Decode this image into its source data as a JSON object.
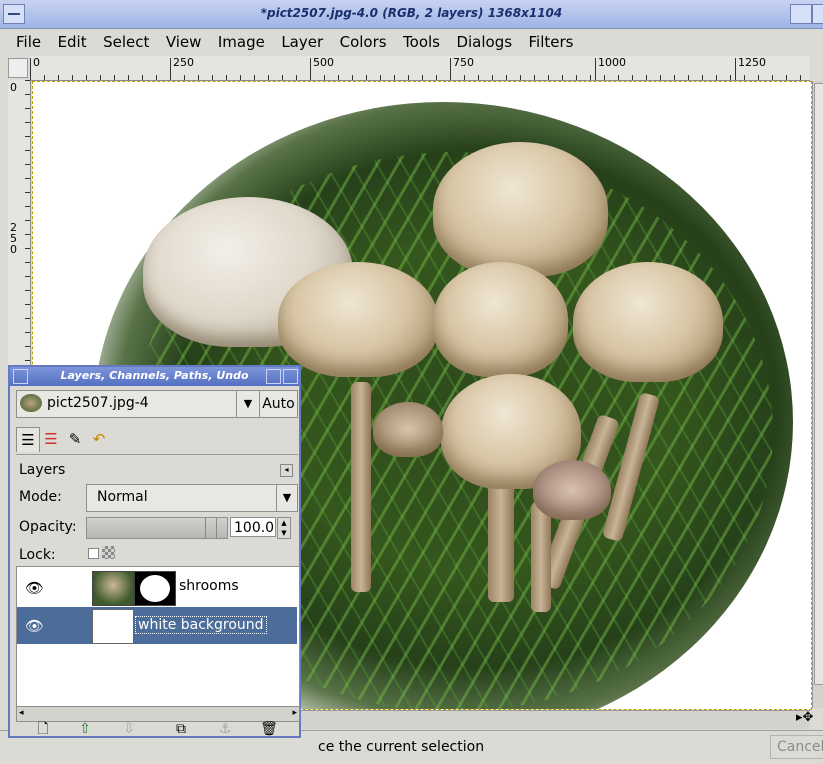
{
  "window": {
    "title": "*pict2507.jpg-4.0 (RGB, 2 layers) 1368x1104"
  },
  "menubar": {
    "items": [
      "File",
      "Edit",
      "Select",
      "View",
      "Image",
      "Layer",
      "Colors",
      "Tools",
      "Dialogs",
      "Filters"
    ]
  },
  "ruler": {
    "h_ticks": [
      "0",
      "250",
      "500",
      "750",
      "1000",
      "1250"
    ],
    "v_ticks": [
      "0",
      "2",
      "5",
      "0"
    ]
  },
  "status": {
    "message": "ce the current selection",
    "cancel_label": "Cancel"
  },
  "layers_dialog": {
    "title": "Layers, Channels, Paths, Undo",
    "image_name": "pict2507.jpg-4",
    "auto_label": "Auto",
    "section_label": "Layers",
    "mode_label": "Mode:",
    "mode_value": "Normal",
    "opacity_label": "Opacity:",
    "opacity_value": "100.0",
    "opacity_fraction": 1.0,
    "lock_label": "Lock:",
    "layers": [
      {
        "name": "shrooms",
        "visible": true,
        "selected": false
      },
      {
        "name": "white background",
        "visible": true,
        "selected": true
      }
    ]
  },
  "icons": {
    "eye": "👁",
    "new_layer": "🗋",
    "raise": "⇧",
    "lower": "⇩",
    "duplicate": "⧉",
    "anchor": "⚓",
    "delete": "🗑"
  }
}
